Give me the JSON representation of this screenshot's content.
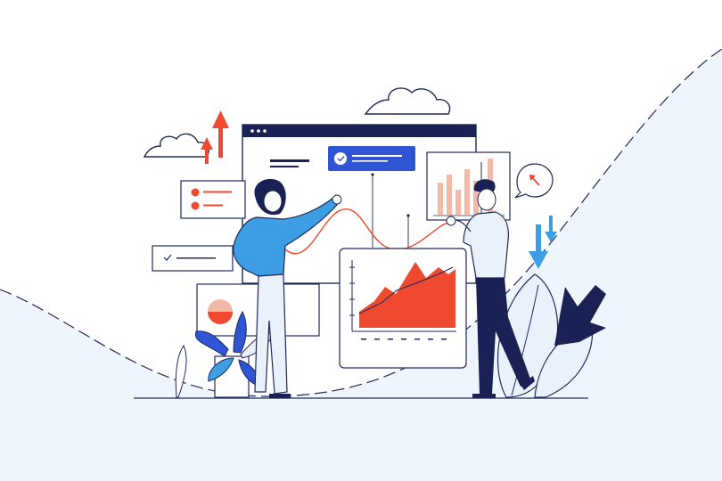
{
  "scene": {
    "colors": {
      "navy": "#1a2154",
      "blue": "#2f55d4",
      "light_blue": "#e9f1fb",
      "sky_blue": "#3d9ee3",
      "red": "#ef4a2f",
      "peach": "#f4b9a6",
      "outline": "#1f2a5a",
      "white": "#ffffff"
    },
    "icons": [
      "cloud-icon",
      "up-arrow-icon",
      "down-arrow-icon",
      "check-icon",
      "pie-chart-icon",
      "bar-chart-icon",
      "area-chart-icon",
      "plant-icon",
      "leaf-icon"
    ]
  }
}
